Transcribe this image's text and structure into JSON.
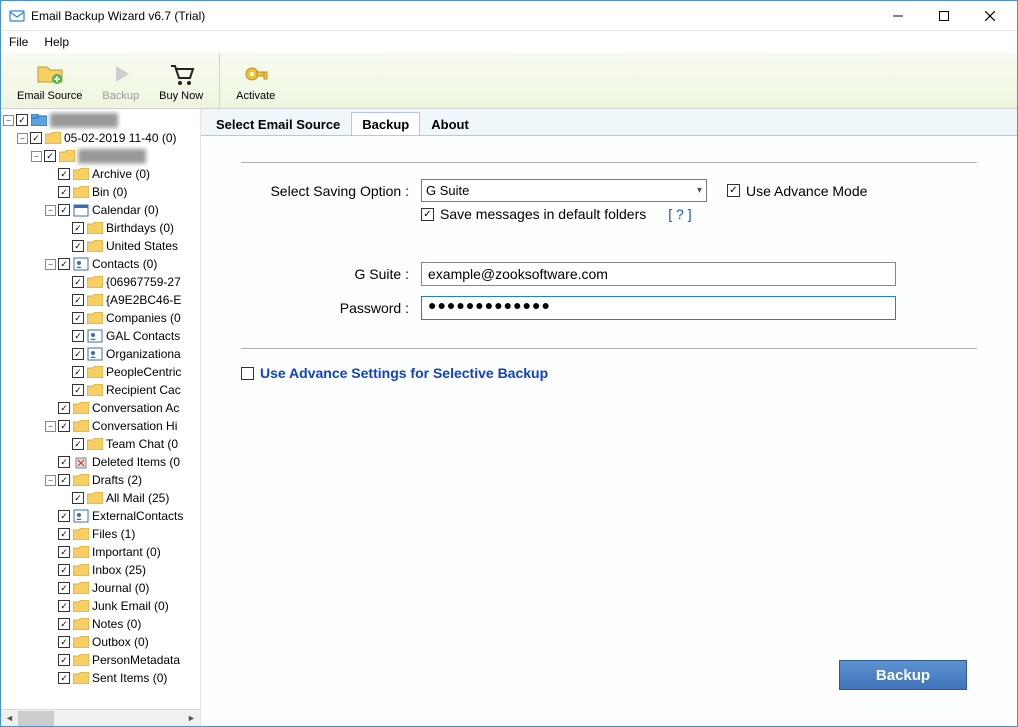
{
  "window": {
    "title": "Email Backup Wizard v6.7 (Trial)"
  },
  "menubar": {
    "file": "File",
    "help": "Help"
  },
  "toolbar": {
    "email_source": "Email Source",
    "backup": "Backup",
    "buy_now": "Buy Now",
    "activate": "Activate"
  },
  "tree": [
    {
      "lvl": 1,
      "toggle": "-",
      "label": "",
      "blur": true,
      "icon": "root"
    },
    {
      "lvl": 2,
      "toggle": "-",
      "label": "05-02-2019 11-40 (0)",
      "icon": "folder"
    },
    {
      "lvl": 3,
      "toggle": "-",
      "label": "",
      "blur": true,
      "icon": "folder"
    },
    {
      "lvl": 4,
      "toggle": "",
      "label": "Archive (0)",
      "icon": "folder"
    },
    {
      "lvl": 4,
      "toggle": "",
      "label": "Bin (0)",
      "icon": "folder"
    },
    {
      "lvl": 4,
      "toggle": "-",
      "label": "Calendar (0)",
      "icon": "cal"
    },
    {
      "lvl": 5,
      "toggle": "",
      "label": "Birthdays (0)",
      "icon": "folder"
    },
    {
      "lvl": 5,
      "toggle": "",
      "label": "United States",
      "icon": "folder"
    },
    {
      "lvl": 4,
      "toggle": "-",
      "label": "Contacts (0)",
      "icon": "contacts"
    },
    {
      "lvl": 5,
      "toggle": "",
      "label": "{06967759-27",
      "icon": "folder"
    },
    {
      "lvl": 5,
      "toggle": "",
      "label": "{A9E2BC46-E",
      "icon": "folder"
    },
    {
      "lvl": 5,
      "toggle": "",
      "label": "Companies (0",
      "icon": "folder"
    },
    {
      "lvl": 5,
      "toggle": "",
      "label": "GAL Contacts",
      "icon": "contacts"
    },
    {
      "lvl": 5,
      "toggle": "",
      "label": "Organizationa",
      "icon": "contacts"
    },
    {
      "lvl": 5,
      "toggle": "",
      "label": "PeopleCentric",
      "icon": "folder"
    },
    {
      "lvl": 5,
      "toggle": "",
      "label": "Recipient Cac",
      "icon": "folder"
    },
    {
      "lvl": 4,
      "toggle": "",
      "label": "Conversation Ac",
      "icon": "folder"
    },
    {
      "lvl": 4,
      "toggle": "-",
      "label": "Conversation Hi",
      "icon": "folder"
    },
    {
      "lvl": 5,
      "toggle": "",
      "label": "Team Chat (0",
      "icon": "folder"
    },
    {
      "lvl": 4,
      "toggle": "",
      "label": "Deleted Items (0",
      "icon": "del"
    },
    {
      "lvl": 4,
      "toggle": "-",
      "label": "Drafts (2)",
      "icon": "folder"
    },
    {
      "lvl": 5,
      "toggle": "",
      "label": "All Mail (25)",
      "icon": "folder"
    },
    {
      "lvl": 4,
      "toggle": "",
      "label": "ExternalContacts",
      "icon": "contacts"
    },
    {
      "lvl": 4,
      "toggle": "",
      "label": "Files (1)",
      "icon": "folder"
    },
    {
      "lvl": 4,
      "toggle": "",
      "label": "Important (0)",
      "icon": "folder"
    },
    {
      "lvl": 4,
      "toggle": "",
      "label": "Inbox (25)",
      "icon": "folder"
    },
    {
      "lvl": 4,
      "toggle": "",
      "label": "Journal (0)",
      "icon": "folder"
    },
    {
      "lvl": 4,
      "toggle": "",
      "label": "Junk Email (0)",
      "icon": "folder"
    },
    {
      "lvl": 4,
      "toggle": "",
      "label": "Notes (0)",
      "icon": "folder"
    },
    {
      "lvl": 4,
      "toggle": "",
      "label": "Outbox (0)",
      "icon": "folder"
    },
    {
      "lvl": 4,
      "toggle": "",
      "label": "PersonMetadata",
      "icon": "folder"
    },
    {
      "lvl": 4,
      "toggle": "",
      "label": "Sent Items (0)",
      "icon": "folder"
    }
  ],
  "tabs": {
    "select_email_source": "Select Email Source",
    "backup": "Backup",
    "about": "About"
  },
  "backup_form": {
    "saving_option_label": "Select Saving Option  :",
    "saving_option_value": "G Suite",
    "advance_mode": "Use Advance Mode",
    "save_default": "Save messages in default folders",
    "help_link": "[  ?  ]",
    "gsuite_label": "G Suite   :",
    "gsuite_value": "example@zooksoftware.com",
    "password_label": "Password  :",
    "password_value": "●●●●●●●●●●●●●",
    "advance_settings": "Use Advance Settings for Selective Backup",
    "backup_btn": "Backup"
  }
}
